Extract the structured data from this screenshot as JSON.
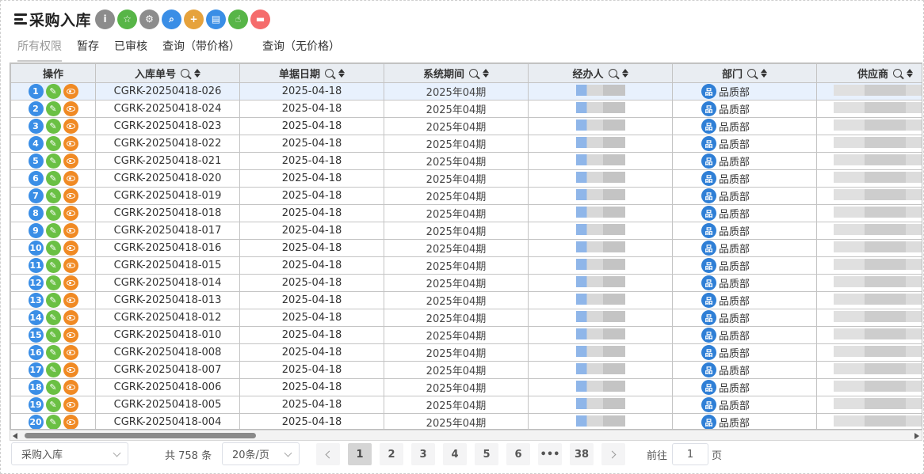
{
  "header": {
    "title": "采购入库",
    "toolbar": [
      {
        "name": "info-button",
        "icon": "info-icon",
        "color": "#8c8c8c",
        "glyph": "i"
      },
      {
        "name": "favorite-button",
        "icon": "star-icon",
        "color": "#57b547",
        "glyph": "☆"
      },
      {
        "name": "settings-button",
        "icon": "gear-icon",
        "color": "#8c8c8c",
        "glyph": "⚙"
      },
      {
        "name": "search-button",
        "icon": "search-icon",
        "color": "#3a8ee6",
        "glyph": "⌕"
      },
      {
        "name": "add-button",
        "icon": "plus-icon",
        "color": "#e6a23c",
        "glyph": "+"
      },
      {
        "name": "document-button",
        "icon": "document-icon",
        "color": "#3a8ee6",
        "glyph": "▤"
      },
      {
        "name": "approve-button",
        "icon": "hand-icon",
        "color": "#57b547",
        "glyph": "☝"
      },
      {
        "name": "delete-button",
        "icon": "trash-icon",
        "color": "#f56c6c",
        "glyph": "▬"
      }
    ]
  },
  "tabs": [
    "所有权限",
    "暂存",
    "已审核",
    "查询（带价格）",
    "查询（无价格）"
  ],
  "table": {
    "columns": [
      "操作",
      "入库单号",
      "单据日期",
      "系统期间",
      "经办人",
      "部门",
      "供应商"
    ],
    "rows": [
      {
        "no": "1",
        "code": "CGRK-20250418-026",
        "date": "2025-04-18",
        "period": "2025年04期",
        "dept": "品质部"
      },
      {
        "no": "2",
        "code": "CGRK-20250418-024",
        "date": "2025-04-18",
        "period": "2025年04期",
        "dept": "品质部"
      },
      {
        "no": "3",
        "code": "CGRK-20250418-023",
        "date": "2025-04-18",
        "period": "2025年04期",
        "dept": "品质部"
      },
      {
        "no": "4",
        "code": "CGRK-20250418-022",
        "date": "2025-04-18",
        "period": "2025年04期",
        "dept": "品质部"
      },
      {
        "no": "5",
        "code": "CGRK-20250418-021",
        "date": "2025-04-18",
        "period": "2025年04期",
        "dept": "品质部"
      },
      {
        "no": "6",
        "code": "CGRK-20250418-020",
        "date": "2025-04-18",
        "period": "2025年04期",
        "dept": "品质部"
      },
      {
        "no": "7",
        "code": "CGRK-20250418-019",
        "date": "2025-04-18",
        "period": "2025年04期",
        "dept": "品质部"
      },
      {
        "no": "8",
        "code": "CGRK-20250418-018",
        "date": "2025-04-18",
        "period": "2025年04期",
        "dept": "品质部"
      },
      {
        "no": "9",
        "code": "CGRK-20250418-017",
        "date": "2025-04-18",
        "period": "2025年04期",
        "dept": "品质部"
      },
      {
        "no": "10",
        "code": "CGRK-20250418-016",
        "date": "2025-04-18",
        "period": "2025年04期",
        "dept": "品质部"
      },
      {
        "no": "11",
        "code": "CGRK-20250418-015",
        "date": "2025-04-18",
        "period": "2025年04期",
        "dept": "品质部"
      },
      {
        "no": "12",
        "code": "CGRK-20250418-014",
        "date": "2025-04-18",
        "period": "2025年04期",
        "dept": "品质部"
      },
      {
        "no": "13",
        "code": "CGRK-20250418-013",
        "date": "2025-04-18",
        "period": "2025年04期",
        "dept": "品质部"
      },
      {
        "no": "14",
        "code": "CGRK-20250418-012",
        "date": "2025-04-18",
        "period": "2025年04期",
        "dept": "品质部"
      },
      {
        "no": "15",
        "code": "CGRK-20250418-010",
        "date": "2025-04-18",
        "period": "2025年04期",
        "dept": "品质部"
      },
      {
        "no": "16",
        "code": "CGRK-20250418-008",
        "date": "2025-04-18",
        "period": "2025年04期",
        "dept": "品质部"
      },
      {
        "no": "17",
        "code": "CGRK-20250418-007",
        "date": "2025-04-18",
        "period": "2025年04期",
        "dept": "品质部"
      },
      {
        "no": "18",
        "code": "CGRK-20250418-006",
        "date": "2025-04-18",
        "period": "2025年04期",
        "dept": "品质部"
      },
      {
        "no": "19",
        "code": "CGRK-20250418-005",
        "date": "2025-04-18",
        "period": "2025年04期",
        "dept": "品质部"
      },
      {
        "no": "20",
        "code": "CGRK-20250418-004",
        "date": "2025-04-18",
        "period": "2025年04期",
        "dept": "品质部"
      }
    ]
  },
  "footer": {
    "module_select": "采购入库",
    "total": "共 758 条",
    "page_size": "20条/页",
    "pages": [
      "1",
      "2",
      "3",
      "4",
      "5",
      "6",
      "•••",
      "38"
    ],
    "current_page": "1",
    "goto_prefix": "前往",
    "goto_value": "1",
    "goto_suffix": "页"
  },
  "colors": {
    "accent": "#3a8ee6",
    "edit": "#6ac044",
    "view": "#f08a24",
    "selected_row": "#e8f1fd"
  }
}
